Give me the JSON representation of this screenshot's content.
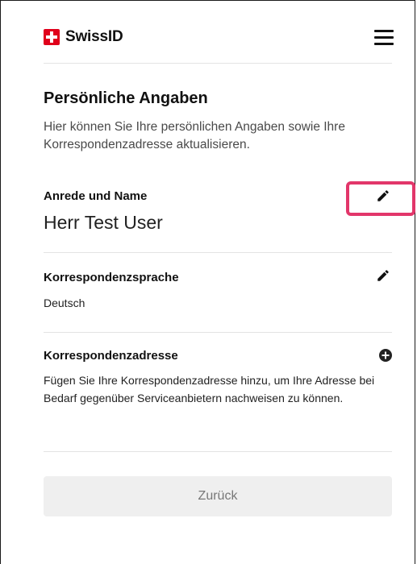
{
  "header": {
    "brand": "SwissID",
    "logo_icon": "swiss-cross-logo-icon",
    "menu_icon": "hamburger-menu-icon",
    "brand_color": "#e0001b"
  },
  "page": {
    "title": "Persönliche Angaben",
    "intro": "Hier können Sie Ihre persönlichen Angaben sowie Ihre Korrespondenzadresse aktualisieren."
  },
  "sections": {
    "name": {
      "label": "Anrede und Name",
      "value": "Herr Test User",
      "action_icon": "pencil-edit-icon"
    },
    "language": {
      "label": "Korrespondenzsprache",
      "value": "Deutsch",
      "action_icon": "pencil-edit-icon"
    },
    "address": {
      "label": "Korrespondenzadresse",
      "description": "Fügen Sie Ihre Korrespondenzadresse hinzu, um Ihre Adresse bei Bedarf gegenüber Serviceanbietern nachweisen zu können.",
      "action_icon": "plus-circle-icon"
    }
  },
  "footer": {
    "back_label": "Zurück"
  },
  "colors": {
    "highlight": "#e2366a",
    "divider": "#e3e3e3",
    "button_bg": "#efefef"
  }
}
